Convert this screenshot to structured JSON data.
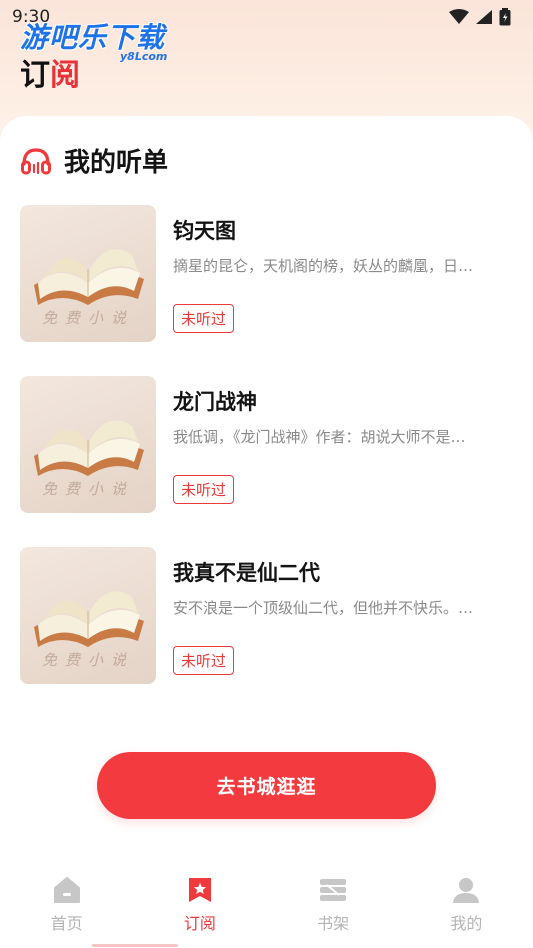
{
  "status_bar": {
    "time": "9:30"
  },
  "watermark": {
    "text": "游吧乐下载",
    "sub": "y8Lcom"
  },
  "header": {
    "title_part1": "订",
    "title_part2": "阅"
  },
  "section": {
    "title": "我的听单",
    "icon": "headphones-icon"
  },
  "books": [
    {
      "title": "钧天图",
      "description": "摘星的昆仑，天机阁的榜，妖丛的麟凰，日…",
      "badge": "未听过",
      "cover_text": "免费小说"
    },
    {
      "title": "龙门战神",
      "description": "我低调，《龙门战神》作者：胡说大师不是…",
      "badge": "未听过",
      "cover_text": "免费小说"
    },
    {
      "title": "我真不是仙二代",
      "description": "安不浪是一个顶级仙二代，但他并不快乐。…",
      "badge": "未听过",
      "cover_text": "免费小说"
    }
  ],
  "cta": {
    "label": "去书城逛逛"
  },
  "tabbar": {
    "items": [
      {
        "label": "首页",
        "icon": "home-icon",
        "active": false
      },
      {
        "label": "订阅",
        "icon": "bookmark-icon",
        "active": true
      },
      {
        "label": "书架",
        "icon": "bookshelf-icon",
        "active": false
      },
      {
        "label": "我的",
        "icon": "user-icon",
        "active": false
      }
    ]
  },
  "colors": {
    "accent": "#f33b3f",
    "inactive": "#b5b5b5"
  }
}
